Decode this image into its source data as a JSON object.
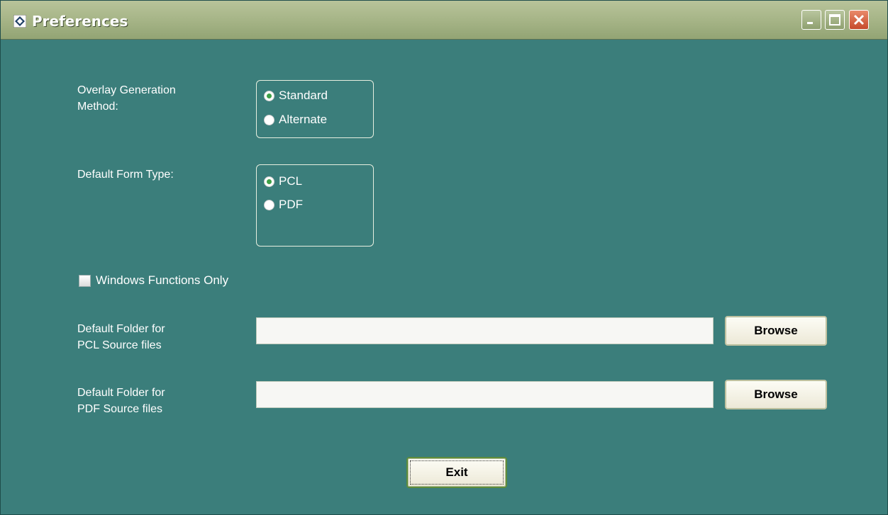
{
  "window": {
    "title": "Preferences"
  },
  "overlay": {
    "label_line1": "Overlay Generation",
    "label_line2": "Method:",
    "options": [
      "Standard",
      "Alternate"
    ],
    "selected": "Standard"
  },
  "form_type": {
    "label": "Default Form Type:",
    "options": [
      "PCL",
      "PDF"
    ],
    "selected": "PCL"
  },
  "windows_only": {
    "label": "Windows Functions Only",
    "checked": false
  },
  "pcl_folder": {
    "label_line1": "Default Folder for",
    "label_line2": "PCL Source files",
    "value": "",
    "browse_label": "Browse"
  },
  "pdf_folder": {
    "label_line1": "Default Folder for",
    "label_line2": "PDF Source files",
    "value": "",
    "browse_label": "Browse"
  },
  "exit_label": "Exit",
  "colors": {
    "background": "#3b7e7b",
    "titlebar": "#aab88b",
    "close": "#d0583a",
    "radio_selected": "#3fa047"
  }
}
